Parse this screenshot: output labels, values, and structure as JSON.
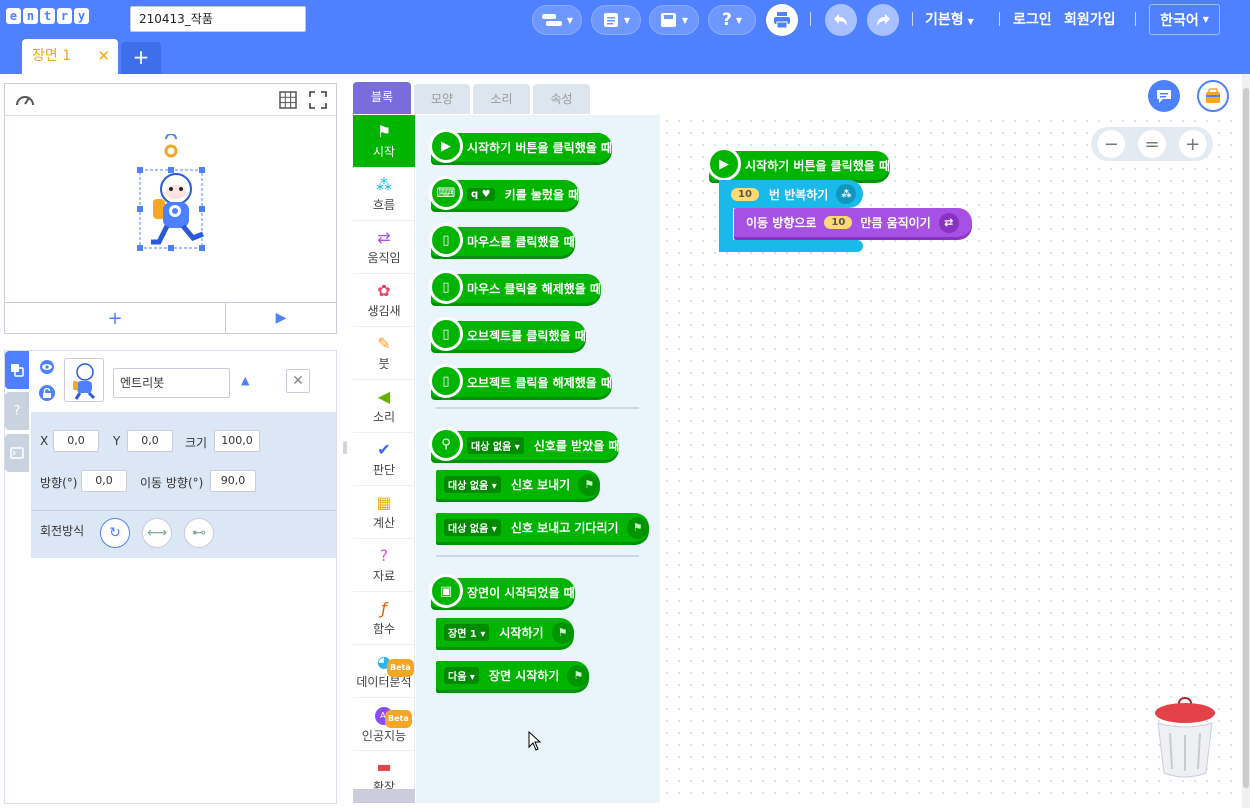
{
  "topbar": {
    "logo_letters": [
      "e",
      "n",
      "t",
      "r",
      "y"
    ],
    "project_name": "210413_작품",
    "help_label": "?",
    "mode_label": "기본형",
    "login_label": "로그인",
    "signup_label": "회원가입",
    "language_label": "한국어",
    "scene_tab_label": "장면 1",
    "scene_tab_close": "✕",
    "scene_add": "+"
  },
  "stage": {
    "add_label": "+",
    "play_label": "▶"
  },
  "object": {
    "name": "엔트리봇",
    "x_label": "X",
    "x_value": "0,0",
    "y_label": "Y",
    "y_value": "0,0",
    "size_label": "크기",
    "size_value": "100,0",
    "direction_label": "방향(°)",
    "direction_value": "0,0",
    "move_direction_label": "이동 방향(°)",
    "move_direction_value": "90,0",
    "rotation_label": "회전방식"
  },
  "block_tabs": [
    "블록",
    "모양",
    "소리",
    "속성"
  ],
  "categories": [
    {
      "label": "시작",
      "icon": "flag-icon"
    },
    {
      "label": "흐름",
      "icon": "flow-icon"
    },
    {
      "label": "움직임",
      "icon": "move-icon"
    },
    {
      "label": "생김새",
      "icon": "looks-icon"
    },
    {
      "label": "붓",
      "icon": "brush-icon"
    },
    {
      "label": "소리",
      "icon": "sound-icon"
    },
    {
      "label": "판단",
      "icon": "check-icon"
    },
    {
      "label": "계산",
      "icon": "calc-icon"
    },
    {
      "label": "자료",
      "icon": "data-icon"
    },
    {
      "label": "함수",
      "icon": "function-icon"
    },
    {
      "label": "데이터분석",
      "icon": "chart-icon"
    },
    {
      "label": "인공지능",
      "icon": "ai-icon"
    },
    {
      "label": "확장",
      "icon": "extension-icon"
    }
  ],
  "beta_label": "Beta",
  "ai_label": "AI",
  "palette": {
    "b1": "시작하기 버튼을 클릭했을 때",
    "b2_chip": "q",
    "b2": "키를 눌렀을 때",
    "b3": "마우스를 클릭했을 때",
    "b4": "마우스 클릭을 해제했을 때",
    "b5": "오브젝트를 클릭했을 때",
    "b6": "오브젝트 클릭을 해제했을 때",
    "b7_chip": "대상 없음",
    "b7": "신호를 받았을 때",
    "b8_chip": "대상 없음",
    "b8": "신호 보내기",
    "b9_chip": "대상 없음",
    "b9": "신호 보내고 기다리기",
    "b10": "장면이 시작되었을 때",
    "b11_chip": "장면 1",
    "b11": "시작하기",
    "b12_chip": "다음",
    "b12": "장면 시작하기"
  },
  "workspace": {
    "start_block": "시작하기 버튼을 클릭했을 때",
    "repeat_count": "10",
    "repeat_label": "번 반복하기",
    "move_prefix": "이동 방향으로",
    "move_amount": "10",
    "move_suffix": "만큼 움직이기",
    "zoom_out": "−",
    "zoom_reset": "=",
    "zoom_in": "+"
  },
  "colors": {
    "brand": "#4f80ff",
    "start_green": "#00b400",
    "flow_blue": "#19baea",
    "move_purple": "#a751e3",
    "active_tab": "#7b6cdb",
    "number_chip": "#ffd974"
  }
}
